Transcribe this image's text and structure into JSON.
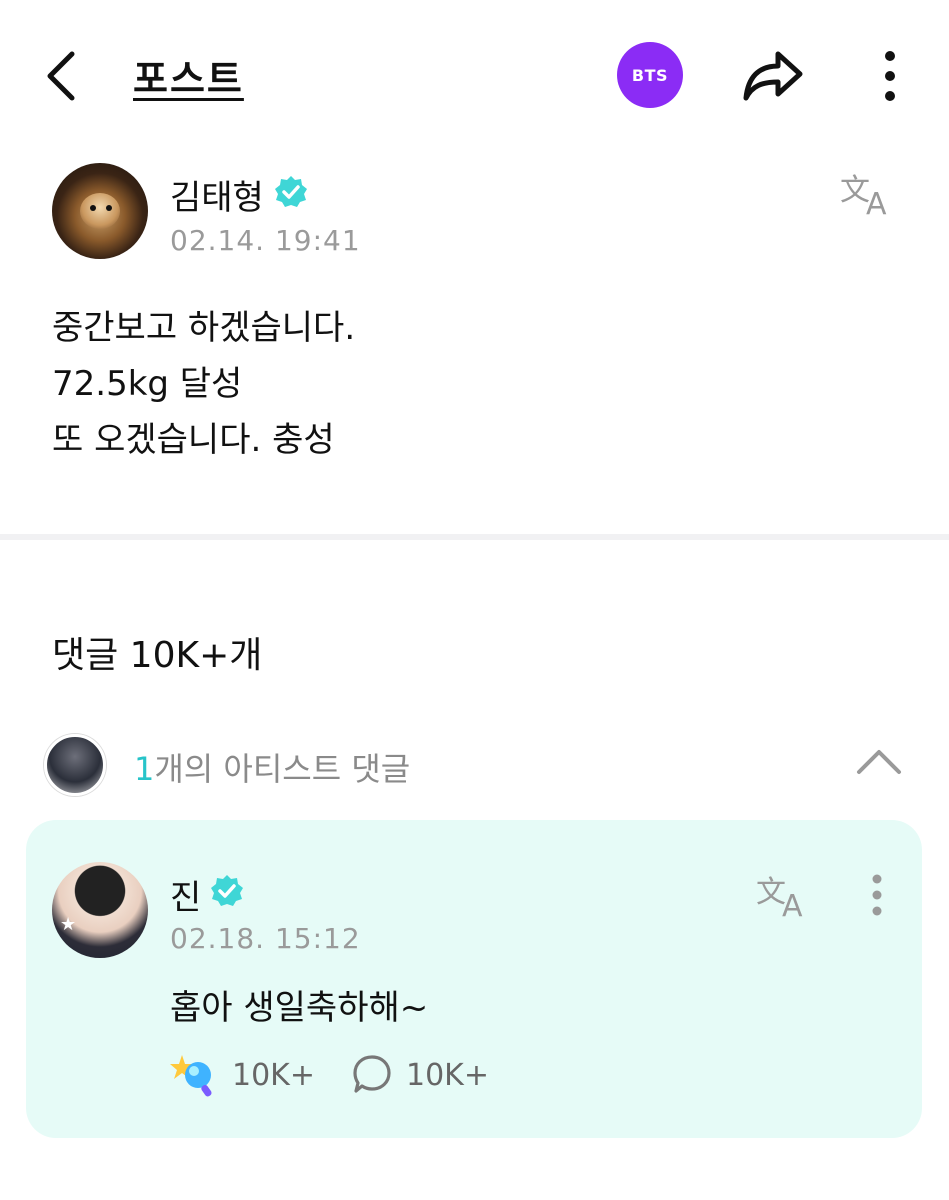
{
  "header": {
    "title": "포스트",
    "community_badge": "BTS",
    "brand_color": "#8b2cf5"
  },
  "post": {
    "author": "김태형",
    "timestamp": "02.14. 19:41",
    "body_lines": [
      "중간보고 하겠습니다.",
      "72.5kg 달성",
      "또 오겠습니다. 충성"
    ]
  },
  "comments": {
    "heading": "댓글 10K+개",
    "artist_summary": {
      "count": "1",
      "label": "개의 아티스트 댓글"
    },
    "artist_comment": {
      "author": "진",
      "timestamp": "02.18. 15:12",
      "text": "홉아 생일축하해~",
      "like_count": "10K+",
      "reply_count": "10K+",
      "card_color": "#e6fbf7"
    }
  },
  "icons": {
    "verified": "verified-badge-icon",
    "translate": "translate-icon",
    "share": "share-icon",
    "more": "more-vertical-icon",
    "like": "lightstick-icon",
    "reply": "speech-bubble-icon"
  },
  "colors": {
    "accent_teal": "#27c4c9",
    "verified": "#3fd6d6"
  }
}
